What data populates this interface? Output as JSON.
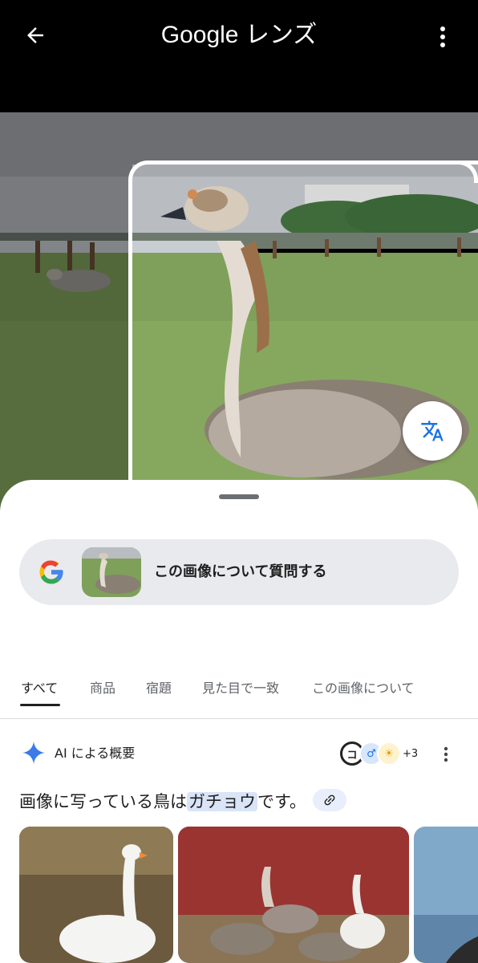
{
  "header": {
    "title": "Google レンズ",
    "back_icon": "arrow-left-icon",
    "more_icon": "more-vert-icon"
  },
  "photo": {
    "subject": "goose",
    "translate_icon": "translate-icon"
  },
  "sheet": {
    "ask_bar": {
      "label": "この画像について質問する",
      "logo": "google-g-logo"
    },
    "tabs": [
      {
        "label": "すべて",
        "active": true
      },
      {
        "label": "商品",
        "active": false
      },
      {
        "label": "宿題",
        "active": false
      },
      {
        "label": "見た目で一致",
        "active": false
      },
      {
        "label": "この画像について",
        "active": false
      }
    ],
    "ai_overview": {
      "label": "AI による概要",
      "source_count": "+3",
      "sources": [
        "コ",
        "♂",
        "☀"
      ]
    },
    "answer": {
      "prefix": "画像に写っている鳥は",
      "highlight": "ガチョウ",
      "suffix": "です。",
      "link_icon": "link-icon"
    }
  },
  "colors": {
    "header_bg": "#000000",
    "sheet_bg": "#ffffff",
    "ask_bar_bg": "#e9eaee",
    "highlight_bg": "#d9e4f7",
    "google_blue": "#4285f4",
    "google_red": "#ea4335",
    "google_yellow": "#fbbc05",
    "google_green": "#34a853"
  }
}
